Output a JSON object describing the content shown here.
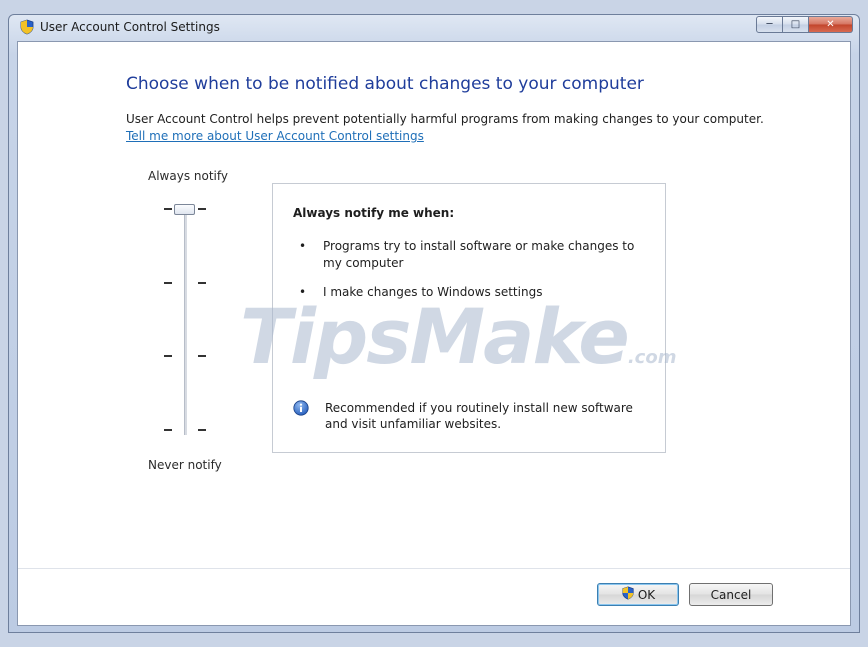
{
  "window": {
    "title": "User Account Control Settings",
    "buttons": {
      "minimize": "─",
      "maximize": "□",
      "close": "✕"
    }
  },
  "main": {
    "heading": "Choose when to be notified about changes to your computer",
    "description": "User Account Control helps prevent potentially harmful programs from making changes to your computer.",
    "help_link": "Tell me more about User Account Control settings"
  },
  "slider": {
    "top_label": "Always notify",
    "bottom_label": "Never notify",
    "levels": 4,
    "selected_level": 1
  },
  "info_box": {
    "title": "Always notify me when:",
    "bullet_char": "•",
    "bullets": [
      "Programs try to install software or make changes to my computer",
      "I make changes to Windows settings"
    ],
    "recommendation": "Recommended if you routinely install new software and visit unfamiliar websites."
  },
  "watermark": {
    "text": "TipsMake",
    "suffix": ".com"
  },
  "footer": {
    "ok_label": "OK",
    "cancel_label": "Cancel"
  },
  "icons": {
    "title": "shield-icon",
    "info": "info-icon",
    "ok": "shield-icon"
  },
  "colors": {
    "heading": "#1f3d9b",
    "link": "#1f6fb8",
    "accent": "#3c7fb1"
  }
}
